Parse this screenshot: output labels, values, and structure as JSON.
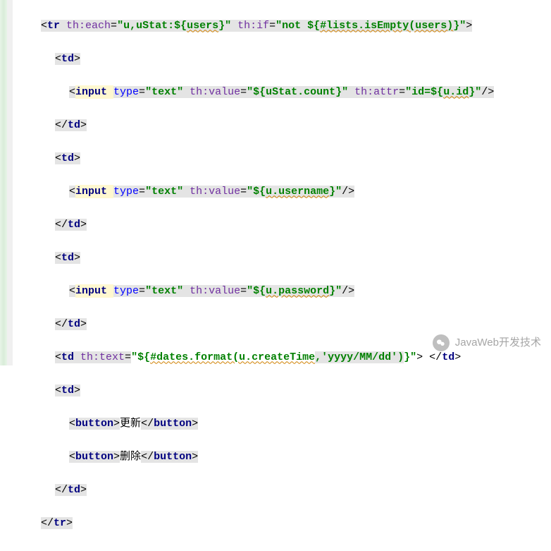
{
  "lines": {
    "l0_pre": "<",
    "l0_tag": "tr ",
    "l0_a1": "th:each",
    "l0_v1a": "\"u,uStat:${",
    "l0_v1b": "users",
    "l0_v1c": "}\" ",
    "l0_a2": "th:if",
    "l0_v2a": "\"not ${",
    "l0_v2b": "#lists.isEmpty(users)",
    "l0_v2c": "}\"",
    "l0_post": ">",
    "td_open_pre": "<",
    "td_open_tag": "td",
    "td_open_post": ">",
    "td_close_pre": "</",
    "td_close_tag": "td",
    "td_close_post": ">",
    "inp_pre": "<",
    "inp_tag": "input ",
    "inp_type_a": "type",
    "inp_type_v": "\"text\" ",
    "inp_val_a": "th:value",
    "inp1_v1a": "\"${uStat.count}\" ",
    "inp1_a2": "th:attr",
    "inp1_v2a": "\"id=${",
    "inp1_v2b": "u.id",
    "inp1_v2c": "}\"",
    "inp2_v1a": "\"${",
    "inp2_v1b": "u.username",
    "inp2_v1c": "}\"",
    "inp3_v1a": "\"${",
    "inp3_v1b": "u.password",
    "inp3_v1c": "}\"",
    "inp_post": "/>",
    "tdtext_pre": "<",
    "tdtext_tag": "td ",
    "tdtext_a": "th:text",
    "tdtext_v1": "\"${",
    "tdtext_v2": "#dates.format(u.createTime",
    "tdtext_v3": ",'yyyy/MM/dd')",
    "tdtext_v4": "}\"",
    "tdtext_mid": "> </",
    "tdtext_tag2": "td",
    "tdtext_post": ">",
    "btn_pre": "<",
    "btn_tag": "button",
    "btn_post": ">",
    "btn_close_pre": "</",
    "btn1_text": "更新",
    "btn2_text": "删除",
    "tr_close_pre": "</",
    "tr_close_tag": "tr",
    "tr_close_post": ">"
  },
  "watermark": {
    "text": "JavaWeb开发技术"
  }
}
